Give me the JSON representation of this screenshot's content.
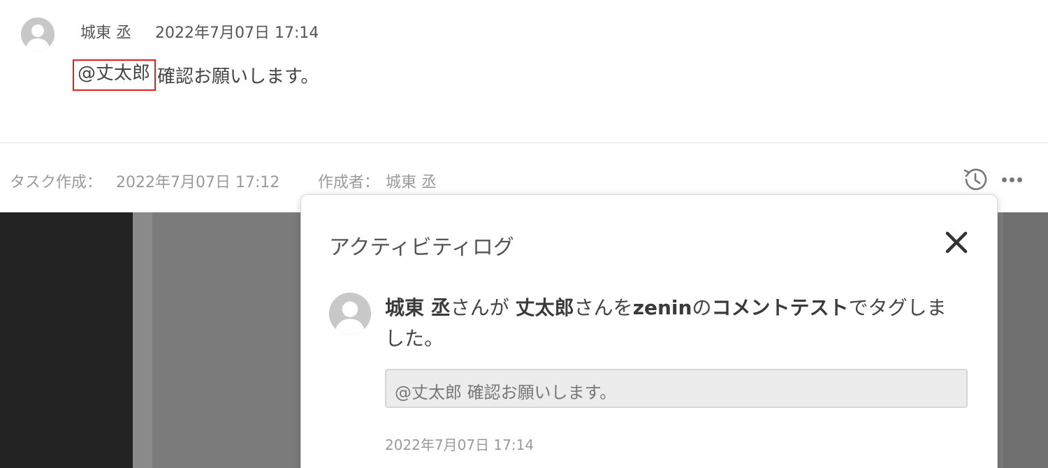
{
  "comment": {
    "author": "城東 丞",
    "date": "2022年7月07日 17:14",
    "mention": "@丈太郎",
    "text": "確認お願いします。"
  },
  "meta": {
    "created_label": "タスク作成：",
    "created_date": "2022年7月07日 17:12",
    "creator_label": "作成者：",
    "creator_name": "城東 丞"
  },
  "modal": {
    "title": "アクティビティログ",
    "entry": {
      "actor": "城東 丞",
      "part1": "さんが ",
      "target": "丈太郎",
      "part2": "さんを",
      "project": "zenin",
      "part3": "の",
      "task": "コメントテスト",
      "part4": "でタグしました。",
      "quote": "@丈太郎 確認お願いします。",
      "date": "2022年7月07日 17:14"
    }
  },
  "icons": {
    "history": "history-icon",
    "more": "more-icon",
    "close": "close-icon",
    "avatar": "user-avatar-icon"
  },
  "colors": {
    "mention_highlight": "#e0201e",
    "dark_panel": "#232323",
    "overlay_gray": "#7b7b7b"
  }
}
